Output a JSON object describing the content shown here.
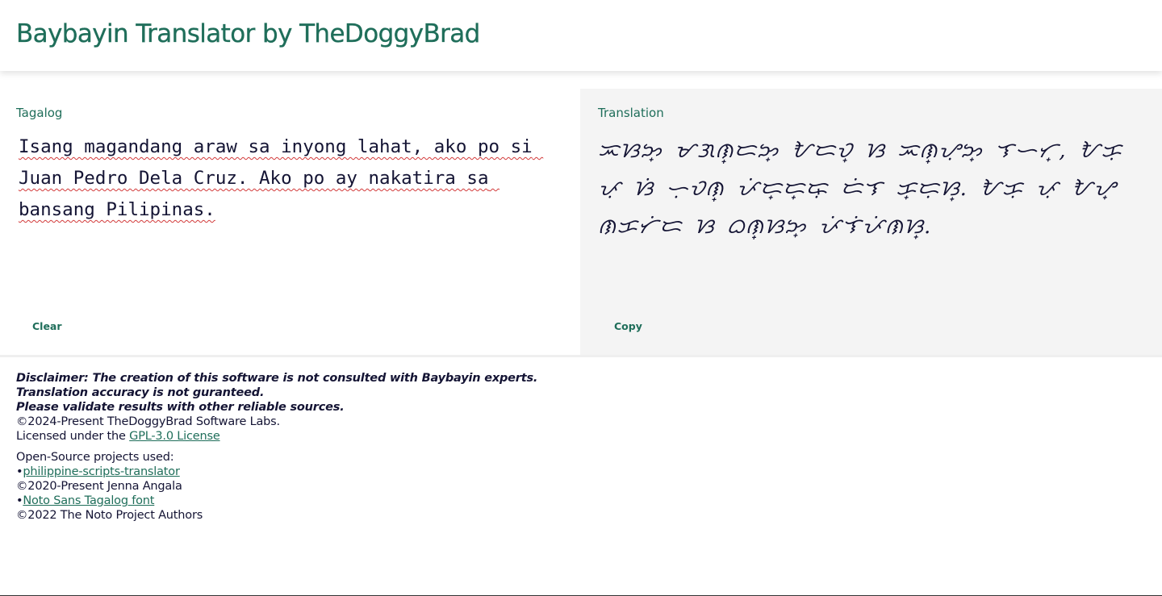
{
  "header": {
    "title": "Baybayin Translator by TheDoggyBrad"
  },
  "input_panel": {
    "label": "Tagalog",
    "text": "Isang magandang araw sa inyong lahat, ako po si Juan Pedro Dela Cruz. Ako po ay nakatira sa bansang Pilipinas.",
    "clear_label": "Clear"
  },
  "output_panel": {
    "label": "Translation",
    "text": "ᜁᜐᜅ᜔ ᜋᜄᜈ᜔ᜇᜅ᜔ ᜀᜇᜏ᜔ ᜐ ᜁᜈ᜔ᜌᜓᜅ᜔ ᜎᜑᜆ᜔, ᜀᜃᜓ ᜉᜓ ᜐᜒ ᜑᜓᜏᜈ᜔ ᜉᜒᜇ᜔ᜇ᜔ᜍᜓ ᜇᜒᜎ ᜃ᜔ᜇᜓᜐ᜔. ᜀᜃᜓ ᜉᜓ ᜀᜌ᜔ ᜈᜃᜆᜒᜇ ᜐ ᜊᜈ᜔ᜐᜅ᜔ ᜉᜒᜎᜒᜉᜒᜈᜐ᜔.",
    "copy_label": "Copy"
  },
  "footer": {
    "disclaimer_1": "Disclaimer: The creation of this software is not consulted with Baybayin experts.",
    "disclaimer_2": "Translation accuracy is not guranteed.",
    "disclaimer_3": "Please validate results with other reliable sources.",
    "copyright": "©2024-Present TheDoggyBrad Software Labs.",
    "license_prefix": "Licensed under the ",
    "license_link": "GPL-3.0 License",
    "oss_heading": "Open-Source projects used:",
    "oss_1_bullet": "•",
    "oss_1_link": "philippine-scripts-translator",
    "oss_1_credit": "©2020-Present Jenna Angala",
    "oss_2_bullet": "•",
    "oss_2_link": "Noto Sans Tagalog font",
    "oss_2_credit": "©2022 The Noto Project Authors"
  },
  "colors": {
    "accent": "#1f6e5a",
    "text": "#141434",
    "output_bg": "#f4f4f4"
  }
}
